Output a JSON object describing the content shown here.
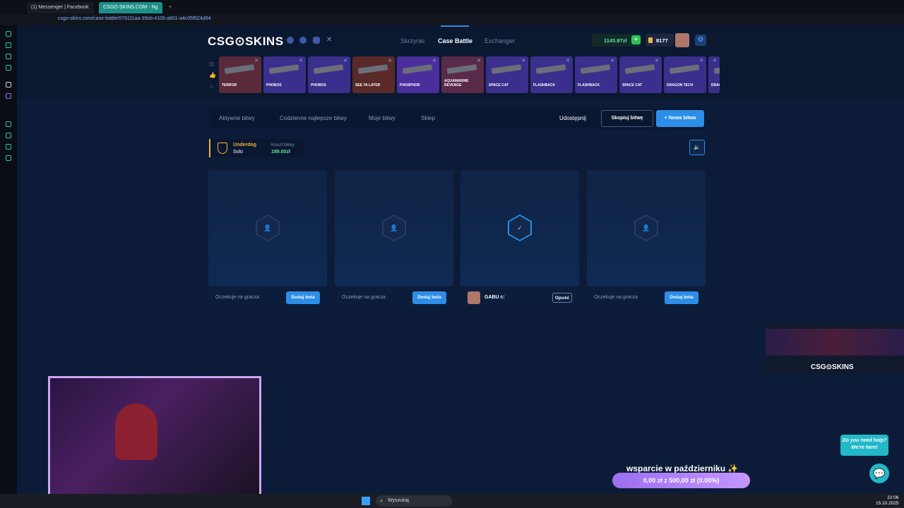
{
  "browser": {
    "tabs": [
      {
        "label": "(1) Messenger | Facebook"
      },
      {
        "label": "CSGO-SKINS.COM - Ng"
      }
    ],
    "url": "csgo-skins.com/case-battle/076111aa-39cb-4105-a601-a4c05f524d94"
  },
  "site": {
    "logo": "CSG⊙SKINS",
    "nav": [
      "Skrzynki",
      "Case Battle",
      "Exchanger"
    ],
    "balance": "1145.97zł",
    "coins": "8177",
    "recent_drops": [
      "TERROR",
      "PHOBOS",
      "PHOBOS",
      "SEE YA LATER",
      "PHOSPHOR",
      "AQUAMARINE REVENGE",
      "SPACE CAT",
      "FLASHBACK",
      "FLASHBACK",
      "SPACE CAT",
      "DRAGON TECH",
      "DRAG"
    ],
    "toolbar": {
      "items": [
        "Aktywne bitwy",
        "Codzienne najlepsze bitwy",
        "Moje bitwy",
        "Sklep"
      ],
      "share": "Udostępnij",
      "copy": "Skopiuj bitwę",
      "new": "+ Nowa bitwa"
    },
    "battle": {
      "mode": "Underdog",
      "mode_sub": "Solo",
      "cost_label": "Koszt bitwy",
      "cost": "189.00zł"
    },
    "players": [
      {
        "status": "Oczekuje na gracza",
        "button": "Dodaj bota"
      },
      {
        "status": "Oczekuje na gracza",
        "button": "Dodaj bota"
      },
      {
        "name": "GABU c:",
        "button": "Opuść"
      },
      {
        "status": "Oczekuje na gracza",
        "button": "Dodaj bota"
      }
    ],
    "overlay": {
      "logo": "CSG⊙SKINS",
      "support_title": "wsparcie w październiku ✨",
      "support_progress": "0,00 zł z 500,00 zł (0.00%)",
      "help": "Do you need help? We're here!"
    }
  },
  "taskbar": {
    "search": "Wyszukaj",
    "time": "22:06",
    "date": "15.10.2025"
  }
}
